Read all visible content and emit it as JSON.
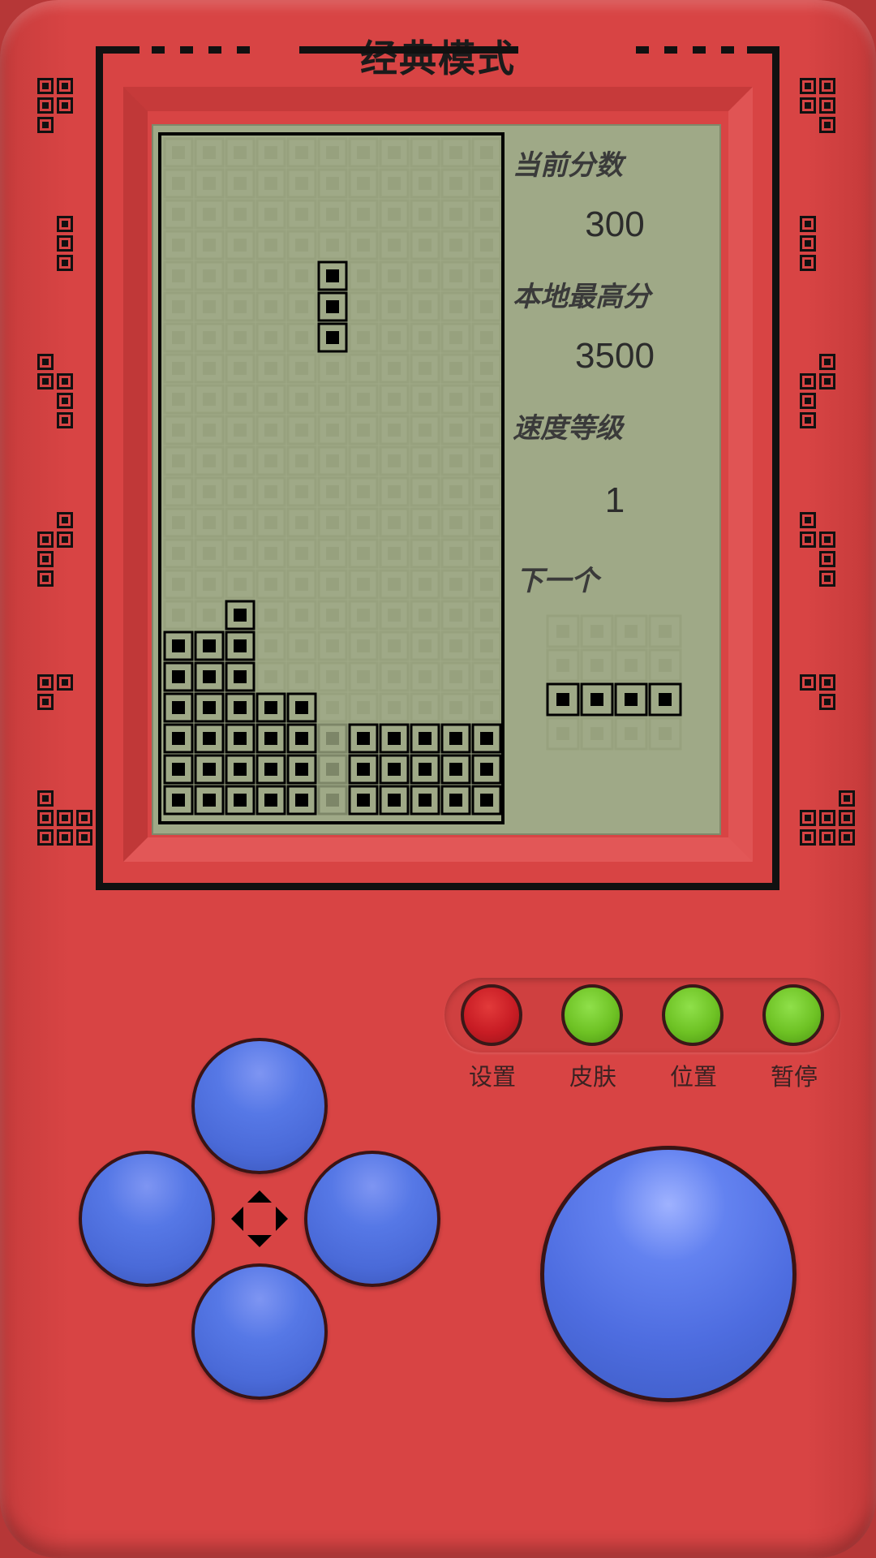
{
  "header": {
    "title": "经典模式"
  },
  "scoreboard": {
    "score_label": "当前分数",
    "score_value": "300",
    "highscore_label": "本地最高分",
    "highscore_value": "3500",
    "level_label": "速度等级",
    "level_value": "1",
    "next_label": "下一个"
  },
  "board": {
    "cols": 11,
    "rows": 22,
    "filled_cells": [
      [
        5,
        4
      ],
      [
        5,
        5
      ],
      [
        5,
        6
      ],
      [
        2,
        15
      ],
      [
        0,
        16
      ],
      [
        1,
        16
      ],
      [
        2,
        16
      ],
      [
        0,
        17
      ],
      [
        1,
        17
      ],
      [
        2,
        17
      ],
      [
        0,
        18
      ],
      [
        1,
        18
      ],
      [
        2,
        18
      ],
      [
        3,
        18
      ],
      [
        4,
        18
      ],
      [
        0,
        19
      ],
      [
        1,
        19
      ],
      [
        2,
        19
      ],
      [
        3,
        19
      ],
      [
        4,
        19
      ],
      [
        6,
        19
      ],
      [
        7,
        19
      ],
      [
        8,
        19
      ],
      [
        9,
        19
      ],
      [
        10,
        19
      ],
      [
        0,
        20
      ],
      [
        1,
        20
      ],
      [
        2,
        20
      ],
      [
        3,
        20
      ],
      [
        4,
        20
      ],
      [
        6,
        20
      ],
      [
        7,
        20
      ],
      [
        8,
        20
      ],
      [
        9,
        20
      ],
      [
        10,
        20
      ],
      [
        0,
        21
      ],
      [
        1,
        21
      ],
      [
        2,
        21
      ],
      [
        3,
        21
      ],
      [
        4,
        21
      ],
      [
        6,
        21
      ],
      [
        7,
        21
      ],
      [
        8,
        21
      ],
      [
        9,
        21
      ],
      [
        10,
        21
      ]
    ],
    "ghost_cells": [
      [
        5,
        19
      ],
      [
        5,
        20
      ],
      [
        5,
        21
      ]
    ]
  },
  "next_piece": {
    "cols": 4,
    "rows": 4,
    "filled_cells": [
      [
        0,
        2
      ],
      [
        1,
        2
      ],
      [
        2,
        2
      ],
      [
        3,
        2
      ]
    ]
  },
  "controls": {
    "settings_label": "设置",
    "skin_label": "皮肤",
    "position_label": "位置",
    "pause_label": "暂停"
  },
  "colors": {
    "body": "#d84444",
    "screen": "#9fa987",
    "block": "#000000",
    "empty_block": "#98a27f",
    "dpad": "#5074e6",
    "settings_button": "#c81c24",
    "other_buttons": "#6ec224"
  }
}
